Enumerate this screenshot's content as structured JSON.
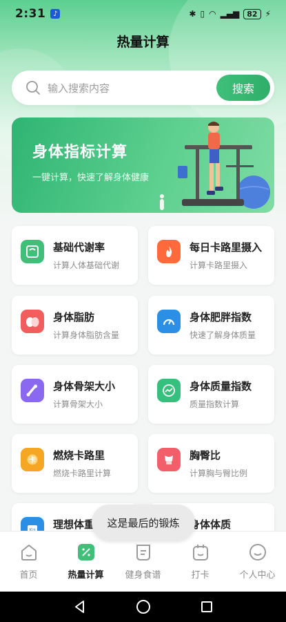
{
  "status": {
    "time": "2:31",
    "battery": "82"
  },
  "page_title": "热量计算",
  "search": {
    "placeholder": "输入搜索内容",
    "button": "搜索"
  },
  "banner": {
    "title": "身体指标计算",
    "subtitle": "一键计算，快速了解身体健康"
  },
  "cards": [
    {
      "title": "基础代谢率",
      "desc": "计算人体基础代谢",
      "icon": "scale-icon",
      "color": "#3fbf78"
    },
    {
      "title": "每日卡路里摄入",
      "desc": "计算卡路里摄入",
      "icon": "flame-icon",
      "color": "#ff6a3d"
    },
    {
      "title": "身体脂肪",
      "desc": "计算身体脂肪含量",
      "icon": "egg-icon",
      "color": "#f25e5e"
    },
    {
      "title": "身体肥胖指数",
      "desc": "快速了解身体质量",
      "icon": "gauge-icon",
      "color": "#2b8fe6"
    },
    {
      "title": "身体骨架大小",
      "desc": "计算骨架大小",
      "icon": "bone-icon",
      "color": "#8a68f0"
    },
    {
      "title": "身体质量指数",
      "desc": "质量指数计算",
      "icon": "trend-icon",
      "color": "#36c07e"
    },
    {
      "title": "燃烧卡路里",
      "desc": "燃烧卡路里计算",
      "icon": "calorie-card-icon",
      "color": "#f5a623"
    },
    {
      "title": "胸臀比",
      "desc": "计算胸与臀比例",
      "icon": "torso-icon",
      "color": "#f25e6a"
    },
    {
      "title": "理想体重",
      "desc": "",
      "icon": "weight-icon",
      "color": "#2b8fe6"
    },
    {
      "title": "身体体质",
      "desc": "",
      "icon": "body-icon",
      "color": "#36c07e"
    }
  ],
  "toast": "这是最后的锻炼",
  "tabs": [
    {
      "label": "首页",
      "icon": "home-icon"
    },
    {
      "label": "热量计算",
      "icon": "calculator-icon",
      "active": true
    },
    {
      "label": "健身食谱",
      "icon": "recipe-icon"
    },
    {
      "label": "打卡",
      "icon": "checkin-icon"
    },
    {
      "label": "个人中心",
      "icon": "profile-icon"
    }
  ],
  "colors": {
    "accent": "#36b873",
    "text": "#222222",
    "muted": "#8c8c8c"
  }
}
